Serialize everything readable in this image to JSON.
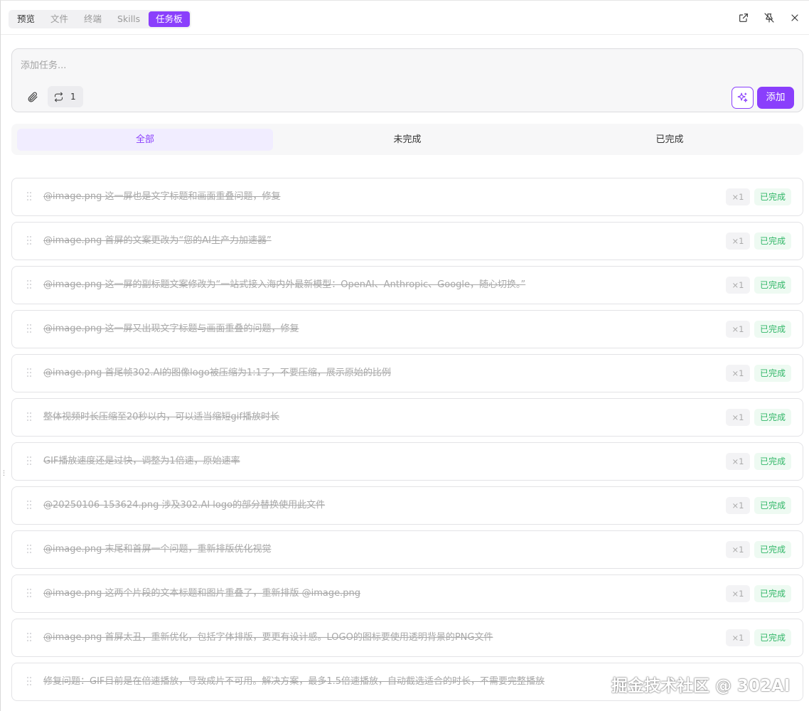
{
  "header": {
    "tabs": [
      {
        "label": "预览"
      },
      {
        "label": "文件"
      },
      {
        "label": "终端"
      },
      {
        "label": "Skills"
      },
      {
        "label": "任务板"
      }
    ],
    "active_tab": "任务板",
    "icons": [
      "open-external-icon",
      "unpin-icon",
      "close-icon"
    ]
  },
  "composer": {
    "placeholder": "添加任务...",
    "value": "",
    "repeat_count": "1",
    "add_label": "添加"
  },
  "filter": {
    "tabs": [
      "全部",
      "未完成",
      "已完成"
    ],
    "active": "全部"
  },
  "tasks": [
    {
      "text": "@image.png 这一屏也是文字标题和画面重叠问题，修复",
      "multiplier": "×1",
      "status": "已完成"
    },
    {
      "text": "@image.png 首屏的文案更改为“您的AI生产力加速器”",
      "multiplier": "×1",
      "status": "已完成"
    },
    {
      "text": "@image.png 这一屏的副标题文案修改为“一站式接入海内外最新模型：OpenAI、Anthropic、Google，随心切换。”",
      "multiplier": "×1",
      "status": "已完成"
    },
    {
      "text": "@image.png 这一屏又出现文字标题与画面重叠的问题，修复",
      "multiplier": "×1",
      "status": "已完成"
    },
    {
      "text": "@image.png 首尾帧302.AI的图像logo被压缩为1:1了，不要压缩，展示原始的比例",
      "multiplier": "×1",
      "status": "已完成"
    },
    {
      "text": "整体视频时长压缩至20秒以内，可以适当缩短gif播放时长",
      "multiplier": "×1",
      "status": "已完成"
    },
    {
      "text": "GIF播放速度还是过快，调整为1倍速，原始速率",
      "multiplier": "×1",
      "status": "已完成"
    },
    {
      "text": "@20250106-153624.png 涉及302.AI logo的部分替换使用此文件",
      "multiplier": "×1",
      "status": "已完成"
    },
    {
      "text": "@image.png 末尾和首屏一个问题，重新排版优化视觉",
      "multiplier": "×1",
      "status": "已完成"
    },
    {
      "text": "@image.png 这两个片段的文本标题和图片重叠了，重新排版 @image.png",
      "multiplier": "×1",
      "status": "已完成"
    },
    {
      "text": "@image.png 首屏太丑，重新优化，包括字体排版，要更有设计感。LOGO的图标要使用透明背景的PNG文件",
      "multiplier": "×1",
      "status": "已完成"
    },
    {
      "text": "修复问题：GIF目前是在倍速播放，导致成片不可用。解决方案，最多1.5倍速播放，自动截选适合的时长，不需要完整播放",
      "multiplier": "",
      "status": ""
    }
  ],
  "watermark": "掘金技术社区 @ 302AI",
  "colors": {
    "accent": "#8a3ffc",
    "done_text": "#32b768",
    "done_bg": "#eefaf2",
    "struck_text": "#a8a8a8"
  }
}
